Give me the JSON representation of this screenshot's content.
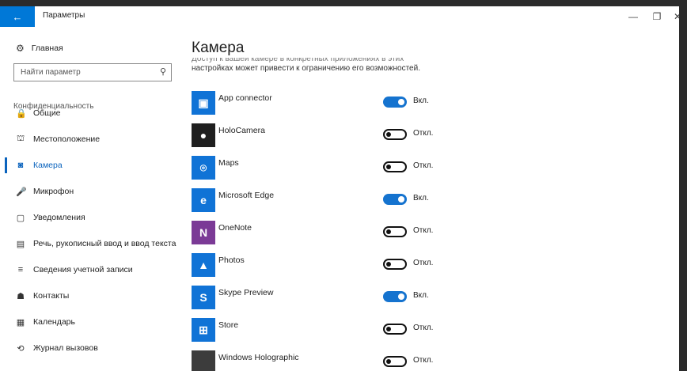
{
  "window": {
    "title": "Параметры",
    "back_icon": "←",
    "minimize_icon": "—",
    "restore_icon": "❐",
    "close_icon": "✕"
  },
  "sidebar": {
    "home": {
      "label": "Главная",
      "icon": "gear-icon",
      "glyph": "⚙"
    },
    "search": {
      "placeholder": "Найти параметр",
      "glyph": "⚲"
    },
    "section_title": "Конфиденциальность",
    "items": [
      {
        "label": "Общие",
        "icon": "lock-icon",
        "glyph": "🔒"
      },
      {
        "label": "Местоположение",
        "icon": "location-person-icon",
        "glyph": "⛫"
      },
      {
        "label": "Камера",
        "icon": "camera-icon",
        "glyph": "◙"
      },
      {
        "label": "Микрофон",
        "icon": "microphone-icon",
        "glyph": "🎤"
      },
      {
        "label": "Уведомления",
        "icon": "notification-icon",
        "glyph": "▢"
      },
      {
        "label": "Речь, рукописный ввод и ввод текста",
        "icon": "clipboard-icon",
        "glyph": "▤"
      },
      {
        "label": "Сведения учетной записи",
        "icon": "account-info-icon",
        "glyph": "≡"
      },
      {
        "label": "Контакты",
        "icon": "contacts-icon",
        "glyph": "☗"
      },
      {
        "label": "Календарь",
        "icon": "calendar-icon",
        "glyph": "▦"
      },
      {
        "label": "Журнал вызовов",
        "icon": "call-history-icon",
        "glyph": "⟲"
      }
    ],
    "active_index": 2
  },
  "main": {
    "title": "Камера",
    "description_cut": "Доступ к вашей камере в конкретных приложениях в этих",
    "description": "настройках может привести к ограничению его возможностей.",
    "apps": [
      {
        "name": "App connector",
        "on": true,
        "state_label": "Вкл.",
        "icon": "app-connector-icon",
        "color": "#1073d6",
        "glyph": "▣"
      },
      {
        "name": "HoloCamera",
        "on": false,
        "state_label": "Откл.",
        "icon": "holocamera-icon",
        "color": "#1f1f1f",
        "glyph": "●"
      },
      {
        "name": "Maps",
        "on": false,
        "state_label": "Откл.",
        "icon": "maps-icon",
        "color": "#1073d6",
        "glyph": "⌾"
      },
      {
        "name": "Microsoft Edge",
        "on": true,
        "state_label": "Вкл.",
        "icon": "edge-icon",
        "color": "#1073d6",
        "glyph": "e"
      },
      {
        "name": "OneNote",
        "on": false,
        "state_label": "Откл.",
        "icon": "onenote-icon",
        "color": "#7b3a96",
        "glyph": "N"
      },
      {
        "name": "Photos",
        "on": false,
        "state_label": "Откл.",
        "icon": "photos-icon",
        "color": "#1073d6",
        "glyph": "▲"
      },
      {
        "name": "Skype Preview",
        "on": true,
        "state_label": "Вкл.",
        "icon": "skype-icon",
        "color": "#1073d6",
        "glyph": "S"
      },
      {
        "name": "Store",
        "on": false,
        "state_label": "Откл.",
        "icon": "store-icon",
        "color": "#1073d6",
        "glyph": "⊞"
      },
      {
        "name": "Windows Holographic",
        "on": false,
        "state_label": "Откл.",
        "icon": "windows-holographic-icon",
        "color": "#3c3c3c",
        "glyph": ""
      }
    ]
  }
}
